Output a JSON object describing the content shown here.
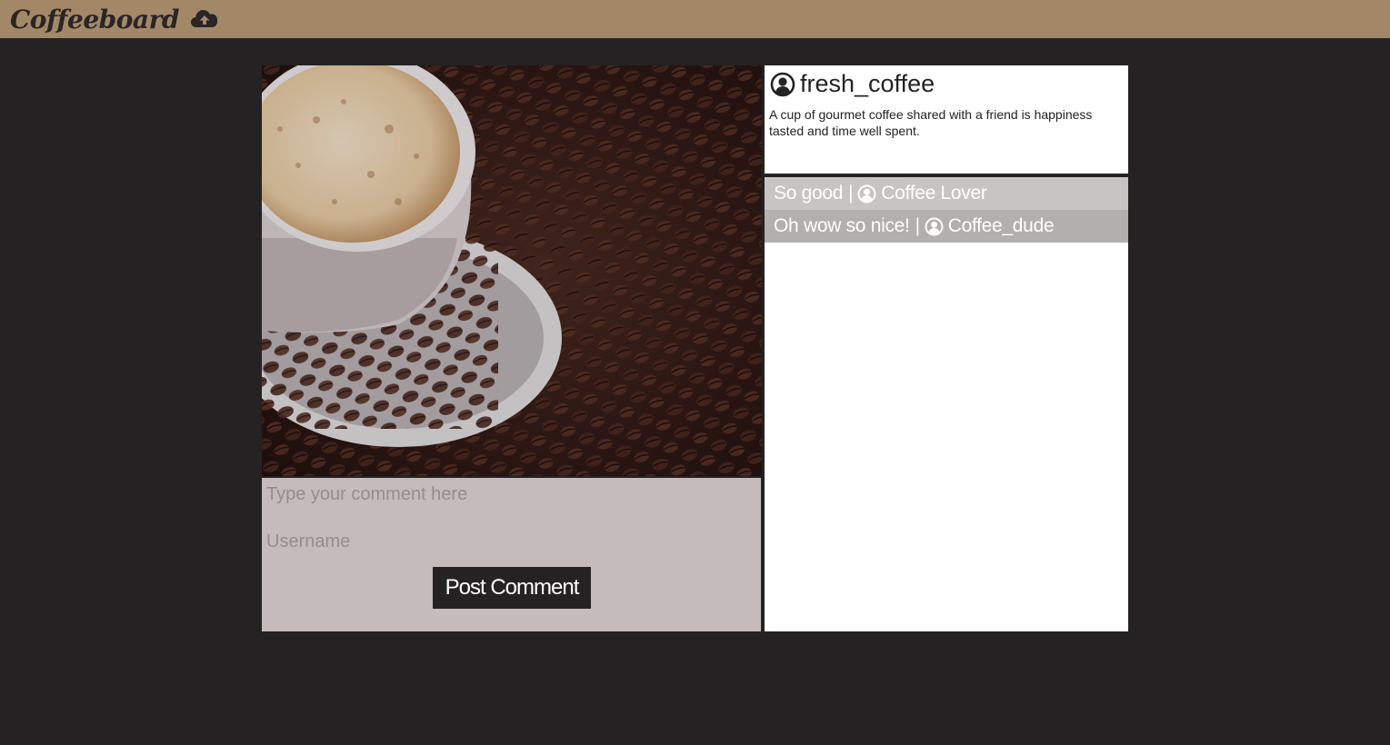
{
  "app": {
    "title": "Coffeeboard",
    "upload_icon": "cloud-upload-icon"
  },
  "post": {
    "image_alt": "coffee cup on coffee beans",
    "author": "fresh_coffee",
    "author_icon": "user-circle-icon",
    "caption": "A cup of gourmet coffee shared with a friend is happiness tasted and time well spent."
  },
  "comment_form": {
    "comment_placeholder": "Type your comment here",
    "username_placeholder": "Username",
    "submit_label": "Post Comment"
  },
  "comments": [
    {
      "text": "So good",
      "separator": "|",
      "user": "Coffee Lover"
    },
    {
      "text": "Oh wow so nice!",
      "separator": "|",
      "user": "Coffee_dude"
    }
  ],
  "colors": {
    "header": "#a38868",
    "background": "#242223",
    "form": "#c5bbbb",
    "comment_row_1": "#c8c4c3",
    "comment_row_2": "#b3afae"
  }
}
